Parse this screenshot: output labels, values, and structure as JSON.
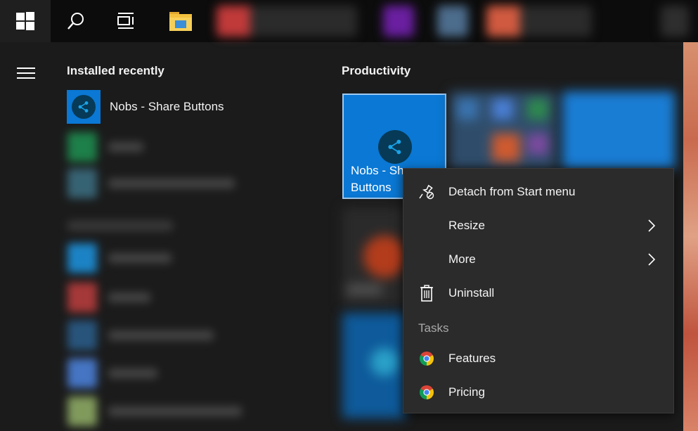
{
  "taskbar": {
    "start_icon": "windows-logo-icon",
    "search_icon": "search-icon",
    "taskview_icon": "task-view-icon",
    "explorer_icon": "file-explorer-icon"
  },
  "start": {
    "menu_icon": "hamburger-icon",
    "installed_recently_title": "Installed recently",
    "recent_app": {
      "label": "Nobs - Share Buttons",
      "icon": "share-icon"
    },
    "productivity_title": "Productivity",
    "tile": {
      "label": "Nobs - Share Buttons",
      "icon": "share-icon"
    }
  },
  "context_menu": {
    "items": [
      {
        "label": "Detach from Start menu",
        "icon": "unpin-icon"
      },
      {
        "label": "Resize",
        "icon": "chevron-right-icon"
      },
      {
        "label": "More",
        "icon": "chevron-right-icon"
      },
      {
        "label": "Uninstall",
        "icon": "trash-icon"
      }
    ],
    "tasks_header": "Tasks",
    "tasks": [
      {
        "label": "Features",
        "icon": "chrome-icon"
      },
      {
        "label": "Pricing",
        "icon": "chrome-icon"
      }
    ]
  },
  "colors": {
    "accent": "#0a78d4",
    "menu_bg": "#2b2b2b",
    "start_bg": "#1b1b1b",
    "taskbar_bg": "#0c0c0c"
  }
}
